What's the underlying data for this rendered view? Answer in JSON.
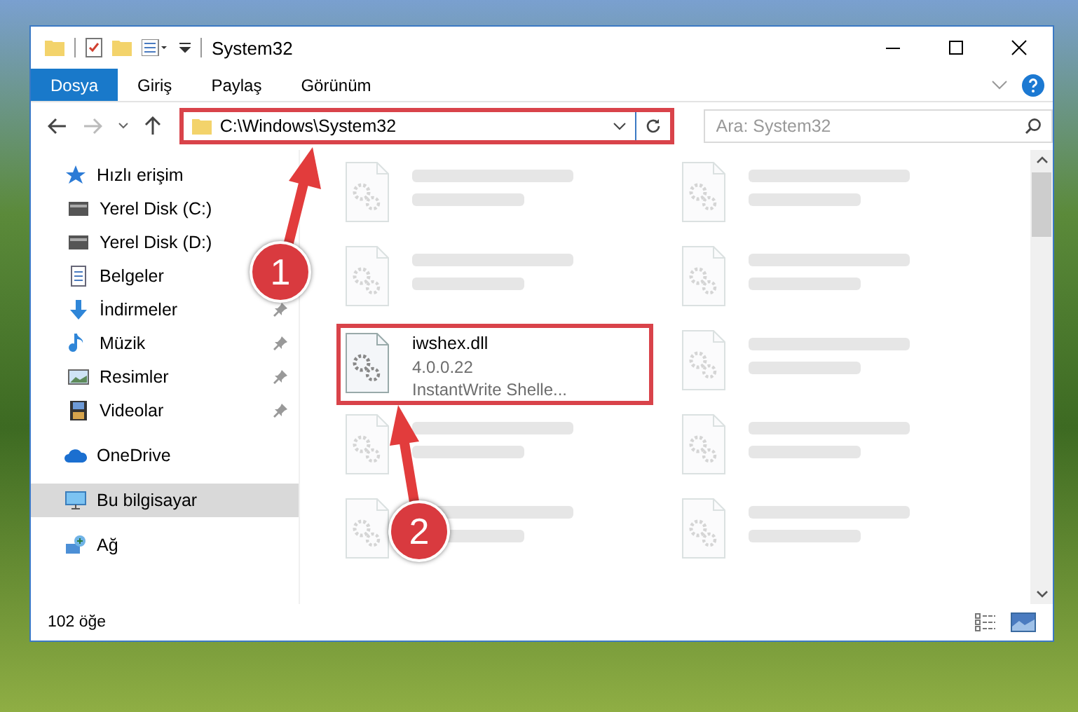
{
  "window": {
    "title": "System32"
  },
  "ribbon_tabs": [
    {
      "label": "Dosya",
      "selected": true
    },
    {
      "label": "Giriş",
      "selected": false
    },
    {
      "label": "Paylaş",
      "selected": false
    },
    {
      "label": "Görünüm",
      "selected": false
    }
  ],
  "address_bar": {
    "path": "C:\\Windows\\System32",
    "highlighted": true
  },
  "search": {
    "placeholder": "Ara: System32"
  },
  "sidebar": {
    "items": [
      {
        "label": "Hızlı erişim",
        "kind": "star",
        "selected": false,
        "children": [
          {
            "label": "Yerel Disk (C:)",
            "kind": "drive",
            "selected": false
          },
          {
            "label": "Yerel Disk (D:)",
            "kind": "drive",
            "selected": false
          },
          {
            "label": "Belgeler",
            "kind": "docs",
            "selected": false
          },
          {
            "label": "İndirmeler",
            "kind": "download",
            "selected": false,
            "pinned": true
          },
          {
            "label": "Müzik",
            "kind": "music",
            "selected": false,
            "pinned": true
          },
          {
            "label": "Resimler",
            "kind": "pictures",
            "selected": false,
            "pinned": true
          },
          {
            "label": "Videolar",
            "kind": "video",
            "selected": false,
            "pinned": true
          }
        ]
      },
      {
        "label": "OneDrive",
        "kind": "cloud",
        "selected": false
      },
      {
        "label": "Bu bilgisayar",
        "kind": "pc",
        "selected": true
      },
      {
        "label": "Ağ",
        "kind": "network",
        "selected": false
      }
    ]
  },
  "files": [
    {
      "kind": "blurred"
    },
    {
      "kind": "blurred"
    },
    {
      "kind": "blurred"
    },
    {
      "kind": "blurred"
    },
    {
      "kind": "file",
      "name": "iwshex.dll",
      "lines": [
        "4.0.0.22",
        "InstantWrite Shelle..."
      ],
      "highlighted": true
    },
    {
      "kind": "blurred"
    },
    {
      "kind": "blurred"
    },
    {
      "kind": "blurred"
    },
    {
      "kind": "blurred"
    },
    {
      "kind": "blurred"
    }
  ],
  "status_bar": {
    "count": "102 öğe"
  },
  "callouts": [
    {
      "label": "1"
    },
    {
      "label": "2"
    }
  ]
}
